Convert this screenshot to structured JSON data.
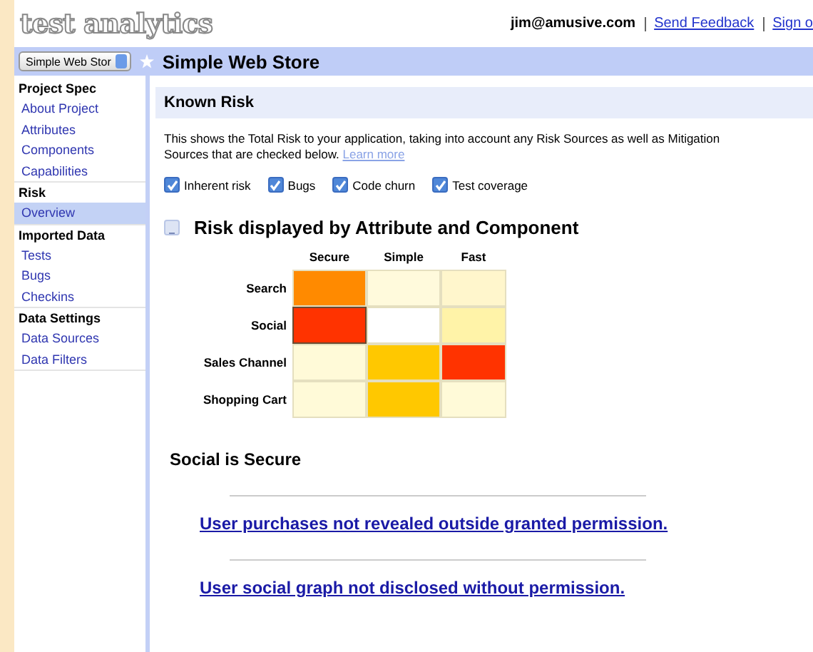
{
  "header": {
    "logo": "test analytics",
    "user": "jim@amusive.com",
    "links": [
      "Send Feedback",
      "Sign o"
    ]
  },
  "project_bar": {
    "selector": "Simple Web Stor",
    "title": "Simple Web Store",
    "starred": false
  },
  "sidebar": {
    "sections": [
      {
        "title": "Project Spec",
        "items": [
          {
            "label": "About Project",
            "selected": false
          },
          {
            "label": "Attributes",
            "selected": false
          },
          {
            "label": "Components",
            "selected": false
          },
          {
            "label": "Capabilities",
            "selected": false
          }
        ]
      },
      {
        "title": "Risk",
        "items": [
          {
            "label": "Overview",
            "selected": true
          }
        ]
      },
      {
        "title": "Imported Data",
        "items": [
          {
            "label": "Tests",
            "selected": false
          },
          {
            "label": "Bugs",
            "selected": false
          },
          {
            "label": "Checkins",
            "selected": false
          }
        ]
      },
      {
        "title": "Data Settings",
        "items": [
          {
            "label": "Data Sources",
            "selected": false
          },
          {
            "label": "Data Filters",
            "selected": false
          }
        ]
      }
    ]
  },
  "panel": {
    "title": "Known Risk",
    "description": "This shows the Total Risk to your application, taking into account any Risk Sources as well as Mitigation Sources that are checked below.",
    "learn_more": "Learn more",
    "filters": [
      {
        "label": "Inherent risk",
        "checked": true
      },
      {
        "label": "Bugs",
        "checked": true
      },
      {
        "label": "Code churn",
        "checked": true
      },
      {
        "label": "Test coverage",
        "checked": true
      }
    ],
    "section": {
      "title": "Risk displayed by Attribute and Component",
      "expanded": true
    },
    "heatmap": {
      "columns": [
        "Secure",
        "Simple",
        "Fast"
      ],
      "rows": [
        {
          "label": "Search",
          "cells": [
            {
              "color": "#ff8a00",
              "selected": false
            },
            {
              "color": "#fffadc",
              "selected": false
            },
            {
              "color": "#fff6cc",
              "selected": false
            }
          ]
        },
        {
          "label": "Social",
          "cells": [
            {
              "color": "#ff3300",
              "selected": true
            },
            {
              "color": "#ffffff",
              "selected": false
            },
            {
              "color": "#fff3a8",
              "selected": false
            }
          ]
        },
        {
          "label": "Sales Channel",
          "cells": [
            {
              "color": "#fffad8",
              "selected": false
            },
            {
              "color": "#ffc800",
              "selected": false
            },
            {
              "color": "#ff3300",
              "selected": false
            }
          ]
        },
        {
          "label": "Shopping Cart",
          "cells": [
            {
              "color": "#fffad8",
              "selected": false
            },
            {
              "color": "#ffc800",
              "selected": false
            },
            {
              "color": "#fffad8",
              "selected": false
            }
          ]
        }
      ]
    },
    "detail": {
      "title": "Social is Secure",
      "capabilities": [
        "User purchases not revealed outside granted permission.",
        "User social graph not disclosed without permission."
      ]
    }
  }
}
